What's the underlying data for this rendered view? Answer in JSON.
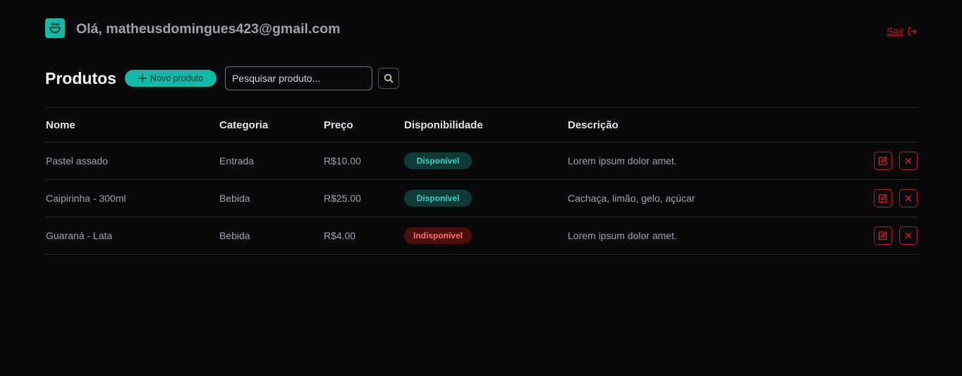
{
  "header": {
    "greeting": "Olá, matheusdomingues423@gmail.com",
    "logo_icon": "bowl-food-icon",
    "logout_label": "Sair",
    "logout_icon": "log-out-icon"
  },
  "toolbar": {
    "title": "Produtos",
    "new_product_label": "Novo produto",
    "search_placeholder": "Pesquisar produto...",
    "search_value": ""
  },
  "table": {
    "headers": [
      "Nome",
      "Categoria",
      "Preço",
      "Disponibilidade",
      "Descrição"
    ],
    "rows": [
      {
        "nome": "Pastel assado",
        "categoria": "Entrada",
        "preco": "R$10.00",
        "disponibilidade": "Disponível",
        "status": "available",
        "descricao": "Lorem ipsum dolor amet."
      },
      {
        "nome": "Caipirinha - 300ml",
        "categoria": "Bebida",
        "preco": "R$25.00",
        "disponibilidade": "Disponível",
        "status": "available",
        "descricao": "Cachaça, limão, gelo, açúcar"
      },
      {
        "nome": "Guaraná - Lata",
        "categoria": "Bebida",
        "preco": "R$4.00",
        "disponibilidade": "Indisponível",
        "status": "unavailable",
        "descricao": "Lorem ipsum dolor amet."
      }
    ]
  },
  "colors": {
    "accent": "#14b8a6",
    "danger": "#b91c1c",
    "background": "#09090b"
  }
}
